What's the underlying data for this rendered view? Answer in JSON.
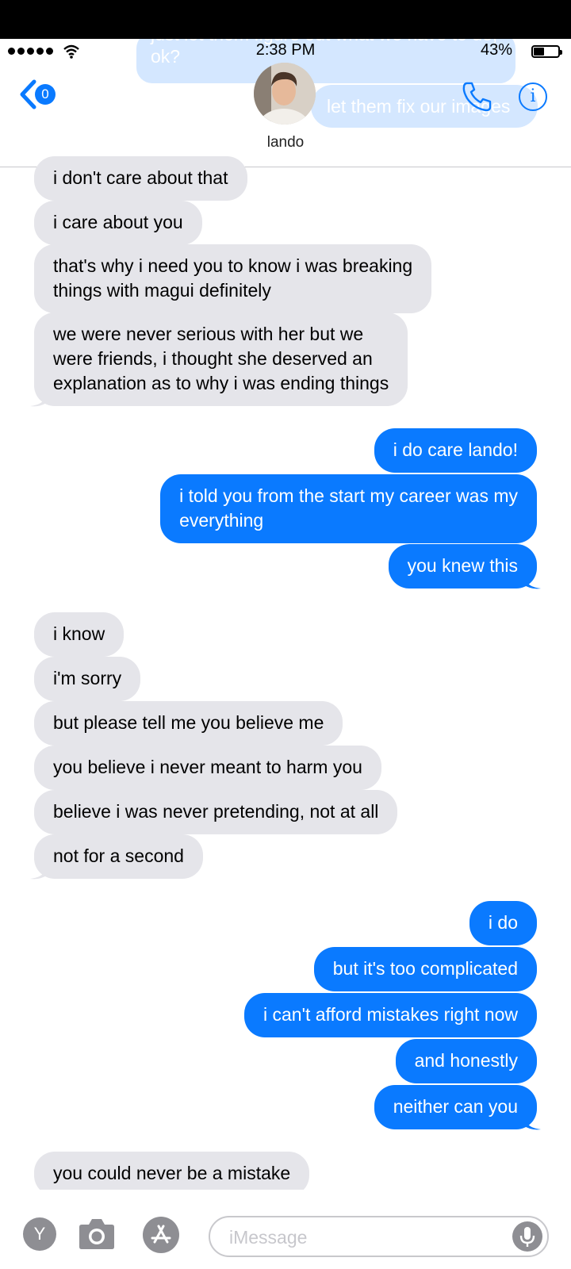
{
  "status_bar": {
    "time": "2:38 PM",
    "battery_percent": "43%",
    "battery_level": 0.43
  },
  "watermarks": {
    "line1": "just let them figure out what we have to do,",
    "line2": "ok?",
    "second": "let them fix our images"
  },
  "header": {
    "back_badge_count": "0",
    "contact_name": "lando"
  },
  "messages": [
    {
      "dir": "in",
      "text": "i don't care about that"
    },
    {
      "dir": "in",
      "text": "i care about you"
    },
    {
      "dir": "in",
      "text": "that's why i need you to know i was breaking\nthings with magui definitely"
    },
    {
      "dir": "in",
      "text": "we were never serious with her but we\nwere friends, i thought she deserved an\nexplanation as to why i was ending things"
    },
    {
      "dir": "out",
      "text": "i do care lando!"
    },
    {
      "dir": "out",
      "text": "i told you from the start my career was my\neverything"
    },
    {
      "dir": "out",
      "text": "you knew this"
    },
    {
      "dir": "in",
      "text": "i know"
    },
    {
      "dir": "in",
      "text": "i'm sorry"
    },
    {
      "dir": "in",
      "text": "but please tell me you believe me"
    },
    {
      "dir": "in",
      "text": "you believe i never meant to harm you"
    },
    {
      "dir": "in",
      "text": "believe i was never pretending, not at all"
    },
    {
      "dir": "in",
      "text": "not for a second"
    },
    {
      "dir": "out",
      "text": "i do"
    },
    {
      "dir": "out",
      "text": "but it's too complicated"
    },
    {
      "dir": "out",
      "text": "i can't afford mistakes right now"
    },
    {
      "dir": "out",
      "text": "and honestly"
    },
    {
      "dir": "out",
      "text": "neither can you"
    },
    {
      "dir": "in",
      "text": "you could never be a mistake"
    }
  ],
  "input_bar": {
    "y_label": "Y",
    "placeholder": "iMessage"
  },
  "colors": {
    "outgoing": "#0a7aff",
    "incoming": "#e5e5ea",
    "accent": "#0a7aff"
  },
  "icons": [
    "signal-dots-icon",
    "wifi-icon",
    "battery-icon",
    "chevron-left-icon",
    "phone-icon",
    "info-icon",
    "camera-icon",
    "app-store-icon",
    "microphone-icon"
  ]
}
